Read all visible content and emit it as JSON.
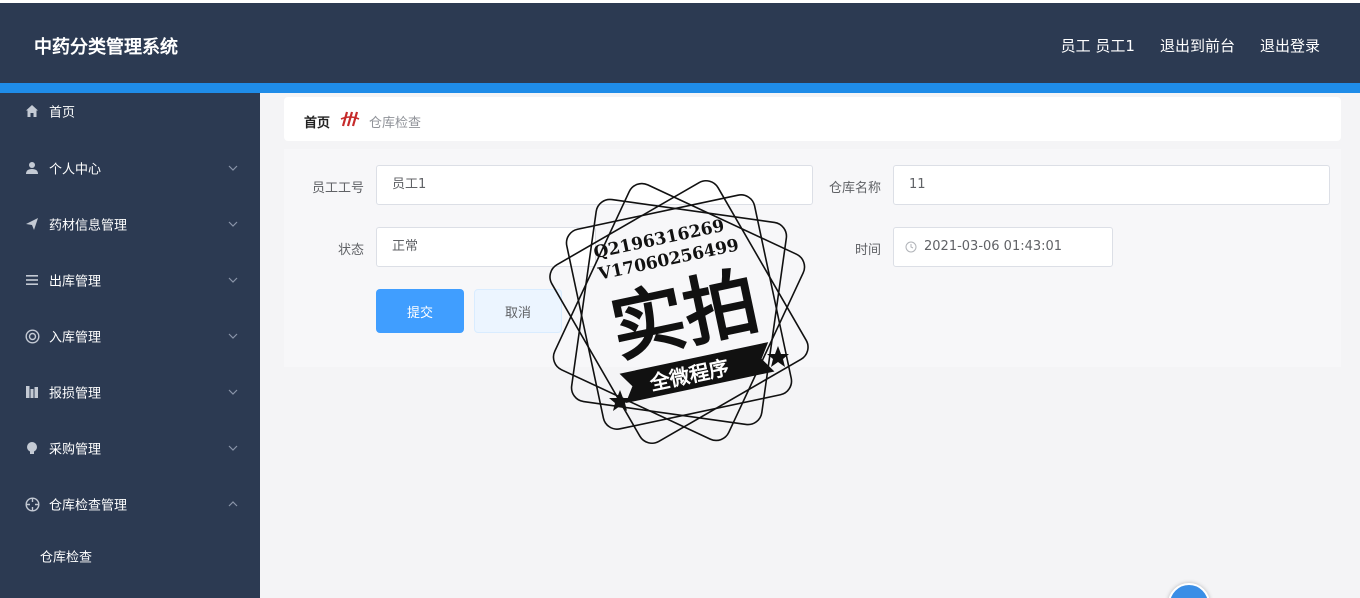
{
  "header": {
    "title": "中药分类管理系统",
    "user": "员工 员工1",
    "to_frontend": "退出到前台",
    "logout": "退出登录"
  },
  "sidebar": {
    "items": [
      {
        "label": "首页",
        "icon": "home-icon"
      },
      {
        "label": "个人中心",
        "icon": "user-icon"
      },
      {
        "label": "药材信息管理",
        "icon": "send-icon"
      },
      {
        "label": "出库管理",
        "icon": "list-icon"
      },
      {
        "label": "入库管理",
        "icon": "lifebuoy-icon"
      },
      {
        "label": "报损管理",
        "icon": "chart-icon"
      },
      {
        "label": "采购管理",
        "icon": "bulb-icon"
      },
      {
        "label": "仓库检查管理",
        "icon": "aperture-icon"
      }
    ],
    "submenu": {
      "label": "仓库检查"
    }
  },
  "breadcrumb": {
    "home": "首页",
    "current": "仓库检查"
  },
  "form": {
    "employee_no_label": "员工工号",
    "employee_no_value": "员工1",
    "warehouse_label": "仓库名称",
    "warehouse_value": "11",
    "status_label": "状态",
    "status_value": "正常",
    "time_label": "时间",
    "time_value": "2021-03-06 01:43:01",
    "submit_label": "提交",
    "cancel_label": "取消"
  },
  "watermark": {
    "line1": "Q2196316269",
    "line2": "V17060256499",
    "main": "实拍",
    "ribbon": "全微程序"
  },
  "colors": {
    "header_bg": "#2c3a52",
    "accent": "#1f8ce8",
    "primary_button": "#409eff"
  }
}
